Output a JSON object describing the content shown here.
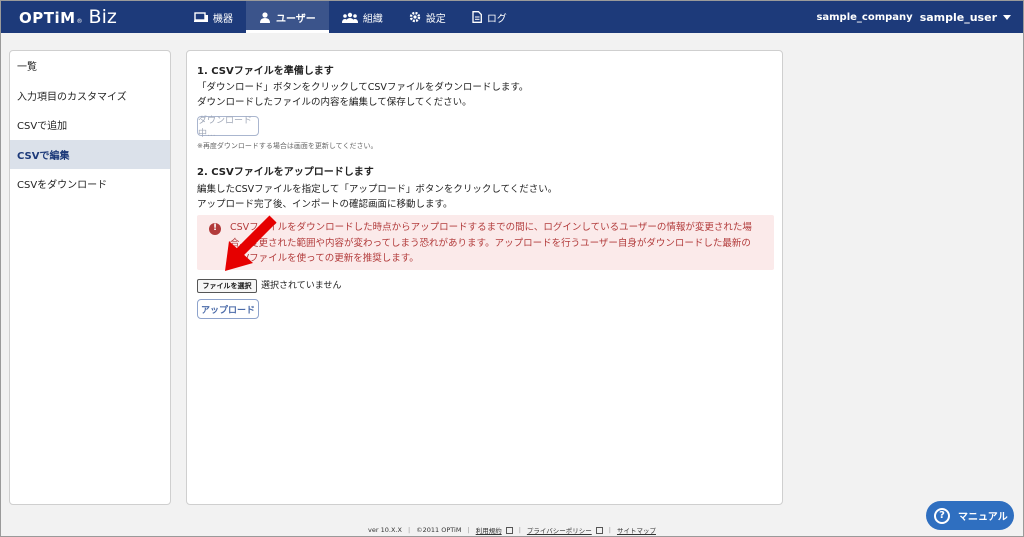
{
  "brand": {
    "name": "OPTiM",
    "tm": "®",
    "product": "Biz"
  },
  "nav": [
    {
      "label": "機器",
      "icon": "device-icon"
    },
    {
      "label": "ユーザー",
      "icon": "user-icon",
      "active": true
    },
    {
      "label": "組織",
      "icon": "organization-icon"
    },
    {
      "label": "設定",
      "icon": "gear-icon"
    },
    {
      "label": "ログ",
      "icon": "document-icon"
    }
  ],
  "account": {
    "company": "sample_company",
    "user": "sample_user"
  },
  "sidebar": {
    "items": [
      {
        "label": "一覧"
      },
      {
        "label": "入力項目のカスタマイズ"
      },
      {
        "label": "CSVで追加"
      },
      {
        "label": "CSVで編集",
        "active": true
      },
      {
        "label": "CSVをダウンロード"
      }
    ]
  },
  "main": {
    "step1": {
      "title": "1. CSVファイルを準備します",
      "line1": "「ダウンロード」ボタンをクリックしてCSVファイルをダウンロードします。",
      "line2": "ダウンロードしたファイルの内容を編集して保存してください。",
      "download_button": "ダウンロード中...",
      "note": "※再度ダウンロードする場合は画面を更新してください。"
    },
    "step2": {
      "title": "2. CSVファイルをアップロードします",
      "line1": "編集したCSVファイルを指定して「アップロード」ボタンをクリックしてください。",
      "line2": "アップロード完了後、インポートの確認画面に移動します。",
      "alert_line1": "CSVファイルをダウンロードした時点からアップロードするまでの間に、ログインしているユーザーの情報が変更された場",
      "alert_line2": "合、変更された範囲や内容が変わってしまう恐れがあります。アップロードを行うユーザー自身がダウンロードした最新の",
      "alert_line3": "CSVファイルを使っての更新を推奨します。",
      "alert_icon": "!",
      "file_button": "ファイルを選択",
      "file_status": "選択されていません",
      "upload_button": "アップロード"
    }
  },
  "footer": {
    "version": "ver 10.X.X",
    "copyright": "©2011 OPTiM",
    "terms": "利用規約",
    "privacy": "プライバシーポリシー",
    "sitemap": "サイトマップ"
  },
  "manual": {
    "label": "マニュアル",
    "icon_char": "?"
  },
  "colors": {
    "header": "#1d3a7a",
    "alert_bg": "#fbeaea",
    "alert_text": "#b23b3b",
    "manual": "#2f6fc0",
    "arrow": "#e60000"
  }
}
